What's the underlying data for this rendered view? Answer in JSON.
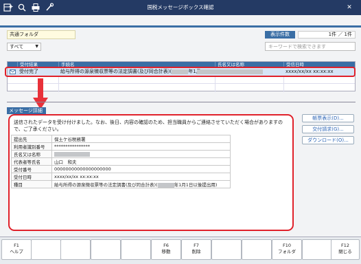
{
  "window": {
    "title": "国税メッセージボックス確認",
    "close_glyph": "✕"
  },
  "toolbar": {
    "icons": [
      "grid-plus-icon",
      "search-doc-icon",
      "print-icon",
      "settings-icon"
    ]
  },
  "folder": {
    "name": "共通フォルダ"
  },
  "filter": {
    "selected": "すべて"
  },
  "count": {
    "label": "表示件数",
    "value": "1件 ／ 1件"
  },
  "search": {
    "placeholder": "キーワードで検索できます"
  },
  "table": {
    "headers": [
      "受付結果",
      "手続名",
      "氏名又は名称",
      "受信日時"
    ],
    "rows": [
      {
        "result": "受付完了",
        "procedure_pre": "給与所得の源泉徴収票等の法定調書(及び同合計表)(",
        "procedure_post": "年1月1",
        "received": "xxxx/xx/xx xx:xx:xx"
      }
    ]
  },
  "message": {
    "tab_label": "メッセージ詳細",
    "body": "送信されたデータを受け付けました。なお、後日、内容の確認のため、担当職員からご連絡させていただく場合がありますので、ご了承ください。",
    "details": [
      {
        "key": "提出先",
        "value": "保土ケ谷税務署"
      },
      {
        "key": "利用者識別番号",
        "value": "****************"
      },
      {
        "key": "氏名又は名称",
        "value": ""
      },
      {
        "key": "代表者等氏名",
        "value": "山口　和夫"
      },
      {
        "key": "受付番号",
        "value": "00000000000000000000"
      },
      {
        "key": "受付日時",
        "value": "xxxx/xx/xx xx:xx:xx"
      },
      {
        "key": "種目",
        "value": "給与所得の源泉徴収票等の法定調書(及び同合計表)(",
        "value_post": "年1月1日以後提出用)"
      }
    ]
  },
  "side_buttons": [
    {
      "label": "帳票表示(D)..."
    },
    {
      "label": "交付請求(G)..."
    },
    {
      "label": "ダウンロード(O)..."
    }
  ],
  "fkeys": [
    {
      "key": "F1",
      "label": "ヘルプ"
    },
    {
      "key": "",
      "label": ""
    },
    {
      "key": "",
      "label": ""
    },
    {
      "key": "",
      "label": ""
    },
    {
      "key": "",
      "label": ""
    },
    {
      "key": "F6",
      "label": "移動"
    },
    {
      "key": "F7",
      "label": "削除"
    },
    {
      "key": "",
      "label": ""
    },
    {
      "key": "",
      "label": ""
    },
    {
      "key": "F10",
      "label": "フォルダ"
    },
    {
      "key": "",
      "label": ""
    },
    {
      "key": "F12",
      "label": "閉じる"
    }
  ]
}
